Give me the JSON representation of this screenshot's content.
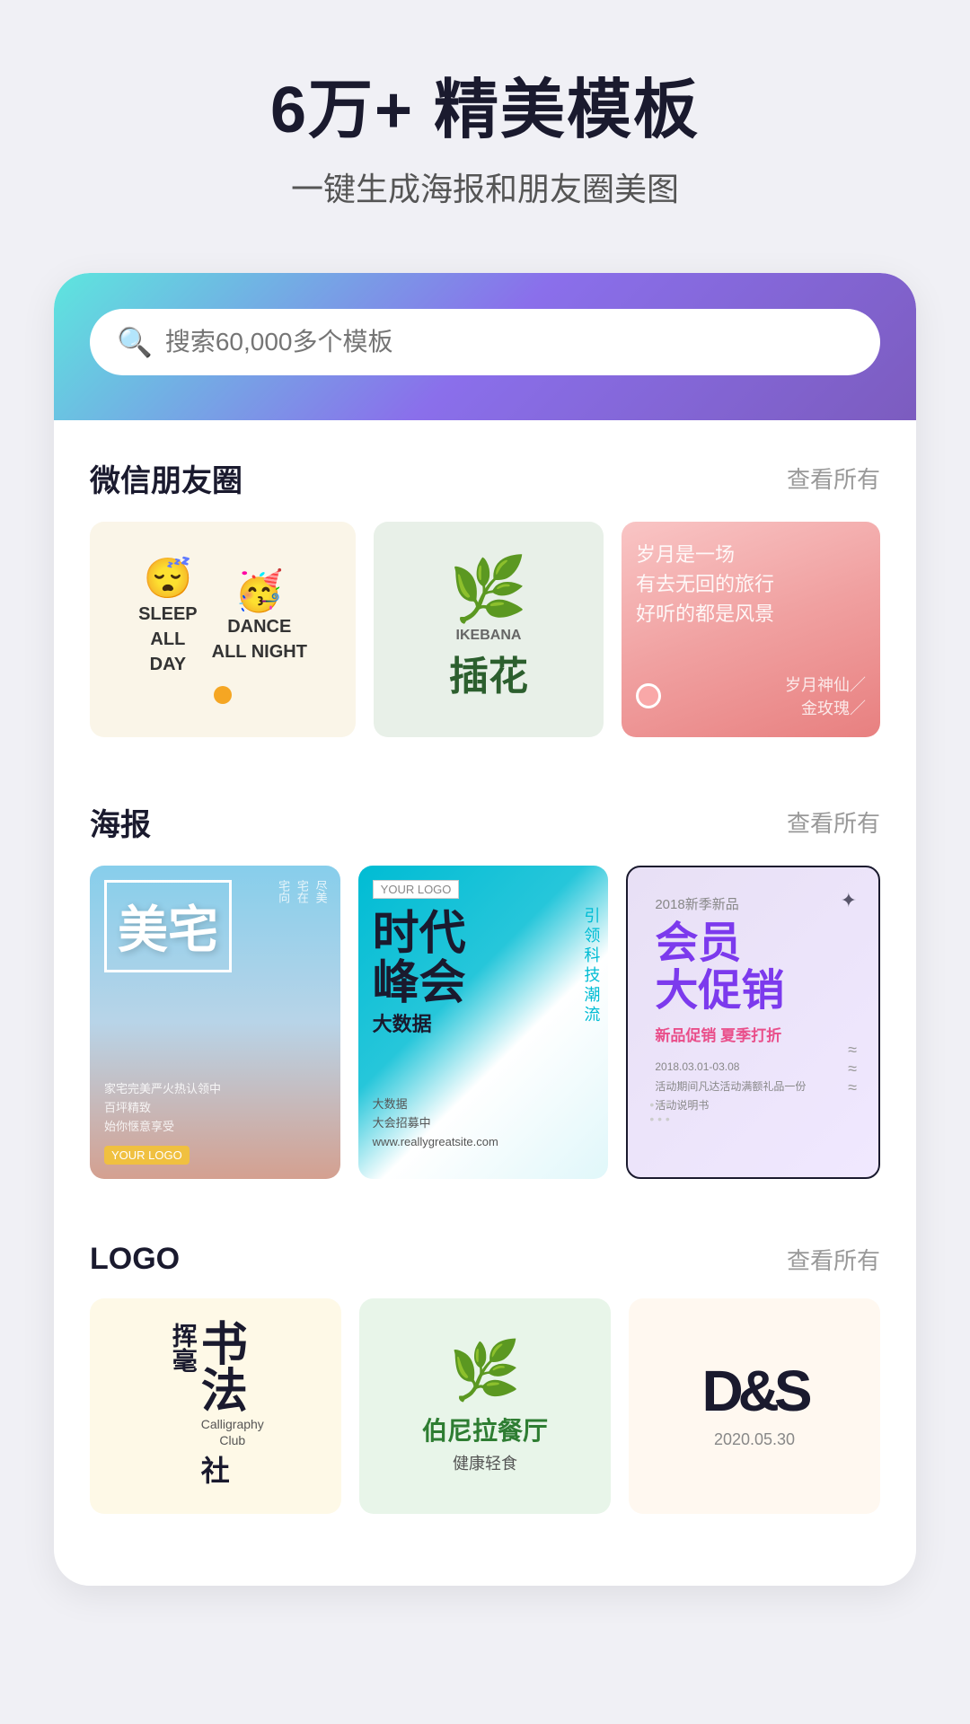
{
  "header": {
    "main_title": "6万+ 精美模板",
    "sub_title": "一键生成海报和朋友圈美图"
  },
  "search": {
    "placeholder": "搜索60,000多个模板"
  },
  "sections": [
    {
      "id": "wechat",
      "title": "微信朋友圈",
      "link": "查看所有",
      "cards": [
        {
          "id": "sleep-dance",
          "line1": "SLEEP",
          "line2": "ALL",
          "line3": "DAY",
          "line4": "DANCE",
          "line5": "ALL NIGHT"
        },
        {
          "id": "ikebana",
          "en": "IKEBANA",
          "cn": "插花"
        },
        {
          "id": "poem",
          "text1": "岁月是一场",
          "text2": "有去无回的旅行",
          "text3": "好听的都是风景",
          "sub1": "岁月神仙／",
          "sub2": "金玫瑰／"
        }
      ]
    },
    {
      "id": "poster",
      "title": "海报",
      "link": "查看所有",
      "cards": [
        {
          "id": "meizhai",
          "main": "美宅",
          "side": "尽美宅在宅向",
          "badge": "YOUR LOGO",
          "bottom": "家宅完美严火热认领中"
        },
        {
          "id": "bigdata",
          "logo": "YOUR LOGO",
          "main": "时代峰会",
          "prefix": "大数据",
          "sub": "引领科技潮流",
          "sub2": "大数据"
        },
        {
          "id": "member",
          "year": "2018新季新品",
          "main": "会员大促销",
          "sub": "新品促销 夏季打折",
          "detail": "2018.03.01-03.08\n活动期间凡达活动满额礼品一份\n活动说明书"
        }
      ]
    },
    {
      "id": "logo",
      "title": "LOGO",
      "link": "查看所有",
      "cards": [
        {
          "id": "calligraphy",
          "cn1": "挥",
          "cn2": "毫",
          "cn3": "书",
          "cn4": "法",
          "en1": "Calligraphy",
          "en2": "Club",
          "en3": "社"
        },
        {
          "id": "restaurant",
          "name": "伯尼拉餐厅",
          "sub": "健康轻食"
        },
        {
          "id": "ds",
          "text": "D&S",
          "date": "2020.05.30"
        }
      ]
    }
  ]
}
